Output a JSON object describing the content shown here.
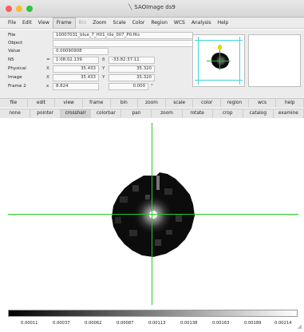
{
  "window": {
    "title": "SAOImage ds9"
  },
  "menubar": {
    "items": [
      "File",
      "Edit",
      "View",
      "Frame",
      "Bin",
      "Zoom",
      "Scale",
      "Color",
      "Region",
      "WCS",
      "Analysis",
      "Help"
    ],
    "active": "Frame"
  },
  "info": {
    "file_label": "File",
    "file_value": "10007031_blue_7_H01_tile_007_P0.fits",
    "object_label": "Object",
    "object_value": "",
    "value_label": "Value",
    "value_value": "0.00090908",
    "n5_label": "N5",
    "n5_sep": "=",
    "n5_ra": "1:08:02.139",
    "n5_dec_sep": "δ",
    "n5_dec": "-33:82:37.11",
    "physical_label": "Physical",
    "physical_x_label": "X",
    "physical_x": "35.433",
    "physical_y_label": "Y",
    "physical_y": "35.320",
    "image_label": "Image",
    "image_x_label": "X",
    "image_x": "35.433",
    "image_y_label": "Y",
    "image_y": "35.320",
    "frame_label": "Frame 2",
    "frame_x_label": "x",
    "frame_zoom": "8.824",
    "frame_angle": "0.000",
    "frame_angle_unit": "°"
  },
  "buttonbar_major": {
    "items": [
      "file",
      "edit",
      "view",
      "frame",
      "bin",
      "zoom",
      "scale",
      "color",
      "region",
      "wcs",
      "help"
    ]
  },
  "buttonbar_minor": {
    "items": [
      "none",
      "pointer",
      "crosshair",
      "colorbar",
      "pan",
      "zoom",
      "rotate",
      "crop",
      "catalog",
      "examine"
    ],
    "active": "crosshair"
  },
  "colorbar": {
    "ticks": [
      "0.00011",
      "0.00037",
      "0.00062",
      "0.00087",
      "0.00113",
      "0.00138",
      "0.00163",
      "0.00189",
      "0.00214"
    ]
  },
  "colors": {
    "crosshair": "#22cc22",
    "panner_box": "#42d4e0",
    "close": "#fc5f57",
    "minimize": "#fdbc2e",
    "maximize": "#28c840"
  },
  "icons": {
    "app": "ds9-app-icon",
    "resize": "resize-grip-icon"
  }
}
